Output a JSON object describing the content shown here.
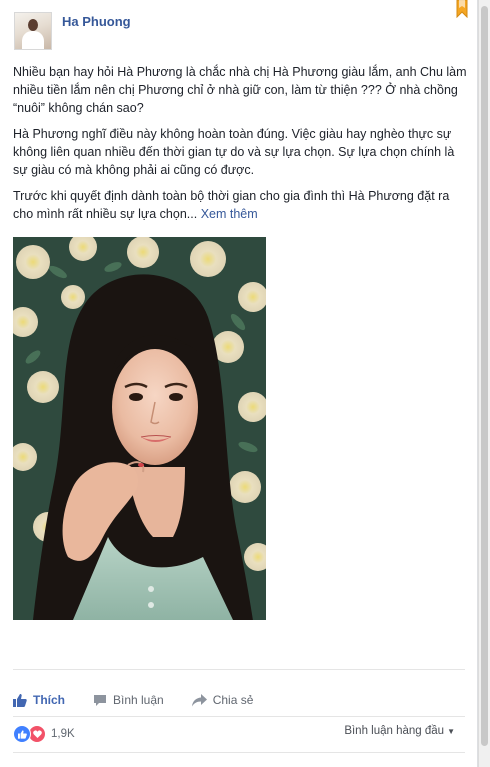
{
  "post": {
    "author": "Ha Phuong",
    "paragraphs": [
      "Nhiều bạn hay hỏi Hà Phương là chắc nhà chị Hà Phương giàu lắm, anh Chu làm nhiều tiền lắm nên chị Phương chỉ ở nhà giữ con, làm từ thiện ??? Ở nhà chồng “nuôi” không chán sao?",
      "Hà Phương nghĩ điều này không hoàn toàn đúng. Việc giàu hay nghèo thực sự không liên quan nhiều đến thời gian tự do và sự lựa chọn. Sự lựa chọn chính là sự giàu có mà không phải ai cũng có được."
    ],
    "last_paragraph": "Trước khi quyết định dành toàn bộ thời gian cho gia đình thì Hà Phương đặt ra cho mình rất nhiều sự lựa chọn...",
    "see_more": "Xem thêm"
  },
  "actions": {
    "like": "Thích",
    "comment": "Bình luận",
    "share": "Chia sẻ"
  },
  "reactions": {
    "count": "1,9K",
    "sort_label": "Bình luận hàng đầu"
  },
  "icons": {
    "like": "thumbs-up-icon",
    "comment": "speech-bubble-icon",
    "share": "share-arrow-icon",
    "love": "heart-icon",
    "bookmark": "bookmark-icon"
  },
  "colors": {
    "link": "#365899",
    "like_blue": "#4267b2",
    "text": "#1d2129",
    "muted": "#616770",
    "love_red": "#f25268"
  }
}
